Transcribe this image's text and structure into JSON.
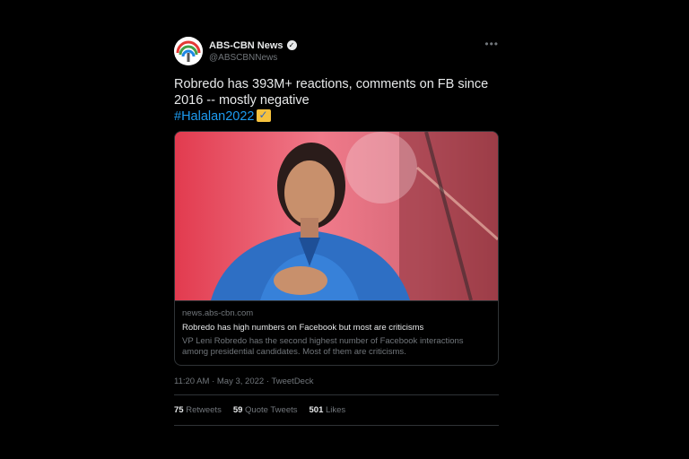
{
  "account": {
    "name": "ABS-CBN News",
    "handle": "@ABSCBNNews",
    "verified_icon": "verified-badge-icon"
  },
  "more_label": "•••",
  "tweet": {
    "text": "Robredo has 393M+ reactions, comments on FB since 2016 -- mostly negative",
    "hashtag": "#Halalan2022"
  },
  "card": {
    "domain": "news.abs-cbn.com",
    "title": "Robredo has high numbers on Facebook but most are criticisms",
    "description": "VP Leni Robredo has the second highest number of Facebook interactions among presidential candidates. Most of them are criticisms."
  },
  "meta": {
    "time": "11:20 AM",
    "separator": "·",
    "date": "May 3, 2022",
    "source": "TweetDeck"
  },
  "stats": [
    {
      "count": "75",
      "label": "Retweets"
    },
    {
      "count": "59",
      "label": "Quote Tweets"
    },
    {
      "count": "501",
      "label": "Likes"
    }
  ],
  "colors": {
    "background": "#000000",
    "text": "#e7e9ea",
    "muted": "#71767b",
    "link": "#1d9bf0",
    "border": "#2f3336"
  }
}
